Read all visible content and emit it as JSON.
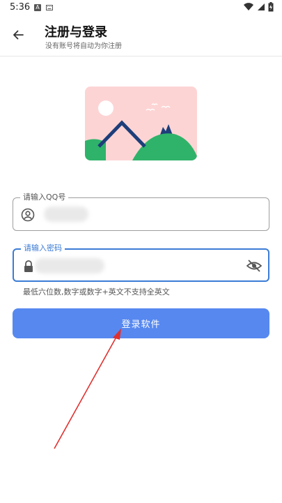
{
  "status_bar": {
    "time": "5:36",
    "notification_icons": [
      "a-icon",
      "keyboard-icon"
    ],
    "system_icons": [
      "wifi-icon",
      "signal-icon",
      "battery-icon"
    ]
  },
  "header": {
    "title": "注册与登录",
    "subtitle": "没有账号将自动为你注册",
    "back_icon": "arrow-left-icon"
  },
  "form": {
    "qq_field": {
      "label": "请输入QQ号",
      "icon": "account-circle-icon",
      "value": "",
      "redacted": true
    },
    "password_field": {
      "label": "请输入密码",
      "icon": "lock-icon",
      "value": "",
      "redacted": true,
      "visibility_icon": "eye-off-icon",
      "focused": true
    },
    "helper_text": "最低六位数,数字或数字+英文不支持全英文",
    "submit_label": "登录软件"
  },
  "colors": {
    "accent": "#5688f0",
    "focus_border": "#3b7bd5",
    "illustration_bg": "#fdd4d4",
    "hill_green": "#2fb36a",
    "house_navy": "#1d3e7a",
    "annotation_arrow": "#e0302e"
  }
}
